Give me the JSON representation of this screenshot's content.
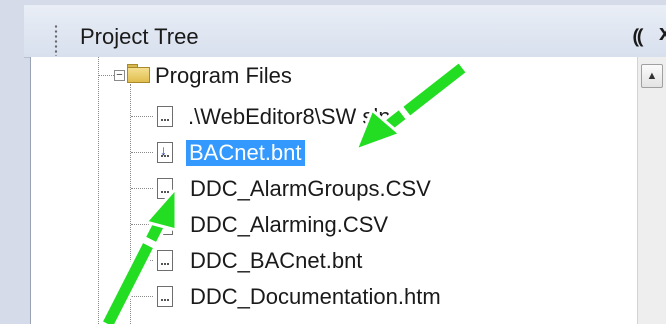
{
  "panel": {
    "title": "Project Tree",
    "pin_glyph": "⸨",
    "close_glyph": "x"
  },
  "tree": {
    "folder": {
      "label": "Program Files",
      "expander_glyph": "−"
    },
    "items": [
      {
        "label": ".\\WebEditor8\\SW    sln",
        "icon": "file-icon",
        "selected": false
      },
      {
        "label": "BACnet.bnt",
        "icon": "download-file-icon",
        "selected": true
      },
      {
        "label": "DDC_AlarmGroups.CSV",
        "icon": "file-icon",
        "selected": false
      },
      {
        "label": "DDC_Alarming.CSV",
        "icon": "file-icon",
        "selected": false
      },
      {
        "label": "DDC_BACnet.bnt",
        "icon": "file-icon",
        "selected": false
      },
      {
        "label": "DDC_Documentation.htm",
        "icon": "file-icon",
        "selected": false
      }
    ]
  },
  "annotation": {
    "arrow_color": "#22dd22",
    "arrow_outline": "#ffffff"
  },
  "colors": {
    "selection": "#3399ff",
    "titlebar": "#dde4f0"
  }
}
